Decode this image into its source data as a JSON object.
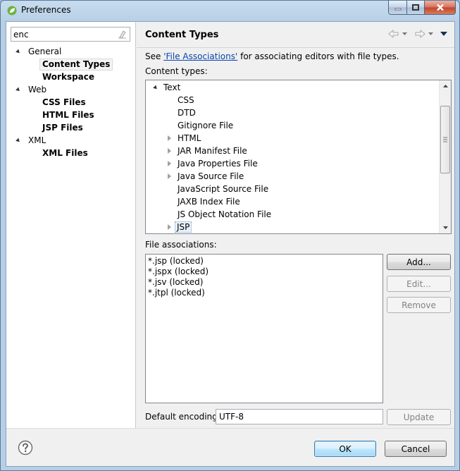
{
  "window": {
    "title": "Preferences"
  },
  "filter": {
    "value": "enc"
  },
  "nav_tree": [
    {
      "label": "General",
      "level": 0,
      "expanded": true,
      "bold": false
    },
    {
      "label": "Content Types",
      "level": 1,
      "bold": true,
      "selected": true
    },
    {
      "label": "Workspace",
      "level": 1,
      "bold": true
    },
    {
      "label": "Web",
      "level": 0,
      "expanded": true,
      "bold": false
    },
    {
      "label": "CSS Files",
      "level": 1,
      "bold": true
    },
    {
      "label": "HTML Files",
      "level": 1,
      "bold": true
    },
    {
      "label": "JSP Files",
      "level": 1,
      "bold": true
    },
    {
      "label": "XML",
      "level": 0,
      "expanded": true,
      "bold": false
    },
    {
      "label": "XML Files",
      "level": 1,
      "bold": true
    }
  ],
  "page": {
    "title": "Content Types",
    "see_prefix": "See ",
    "see_link": "'File Associations'",
    "see_suffix": " for associating editors with file types.",
    "content_types_label": "Content types:",
    "file_assoc_label": "File associations:",
    "encoding_label": "Default encoding:",
    "encoding_value": "UTF-8"
  },
  "content_types": [
    {
      "label": "Text",
      "level": 0,
      "arrow": "expanded"
    },
    {
      "label": "CSS",
      "level": 1,
      "arrow": "none"
    },
    {
      "label": "DTD",
      "level": 1,
      "arrow": "none"
    },
    {
      "label": "Gitignore File",
      "level": 1,
      "arrow": "none"
    },
    {
      "label": "HTML",
      "level": 1,
      "arrow": "collapsed"
    },
    {
      "label": "JAR Manifest File",
      "level": 1,
      "arrow": "collapsed"
    },
    {
      "label": "Java Properties File",
      "level": 1,
      "arrow": "collapsed"
    },
    {
      "label": "Java Source File",
      "level": 1,
      "arrow": "collapsed"
    },
    {
      "label": "JavaScript Source File",
      "level": 1,
      "arrow": "none"
    },
    {
      "label": "JAXB Index File",
      "level": 1,
      "arrow": "none"
    },
    {
      "label": "JS Object Notation File",
      "level": 1,
      "arrow": "none"
    },
    {
      "label": "JSP",
      "level": 1,
      "arrow": "collapsed",
      "selected": true
    }
  ],
  "file_associations": [
    "*.jsp (locked)",
    "*.jspx (locked)",
    "*.jsv (locked)",
    "*.jtpl (locked)"
  ],
  "buttons": {
    "add": "Add...",
    "edit": "Edit...",
    "remove": "Remove",
    "update": "Update",
    "ok": "OK",
    "cancel": "Cancel"
  },
  "icons": {
    "app": "spring-leaf-icon",
    "filter_clear": "eraser-icon",
    "back": "back-arrow-icon",
    "forward": "forward-arrow-icon",
    "view_menu": "view-menu-icon",
    "help": "help-icon"
  },
  "colors": {
    "link": "#0645ad",
    "ok_border": "#3c7fb1",
    "close_button": "#c2442a"
  }
}
